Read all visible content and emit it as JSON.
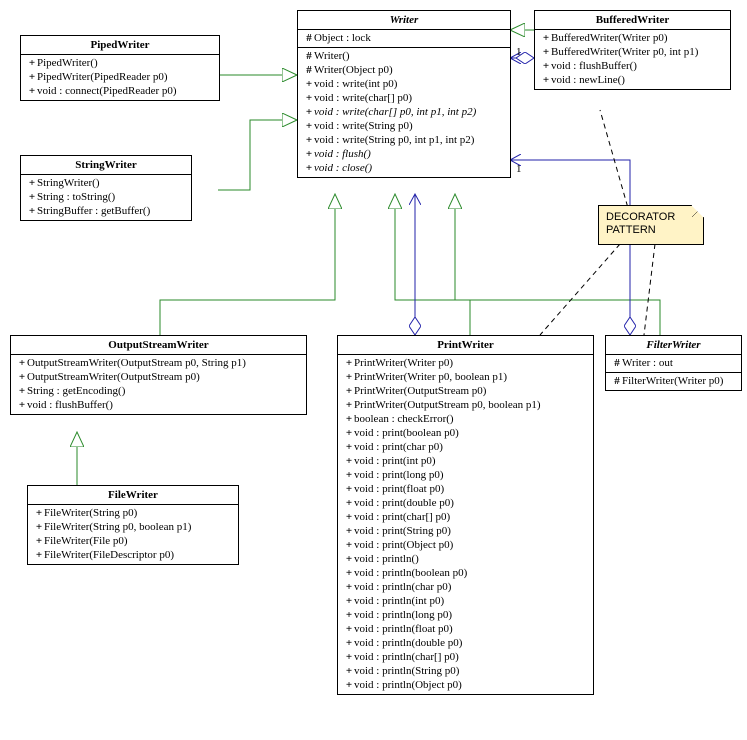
{
  "note": {
    "line1": "DECORATOR",
    "line2": "PATTERN"
  },
  "classes": {
    "Writer": {
      "name": "Writer",
      "abstract": true,
      "attrs": [
        {
          "vis": "#",
          "text": "Object : lock"
        }
      ],
      "ops": [
        {
          "vis": "#",
          "text": "Writer()"
        },
        {
          "vis": "#",
          "text": "Writer(Object p0)"
        },
        {
          "vis": "+",
          "text": "void : write(int p0)"
        },
        {
          "vis": "+",
          "text": "void : write(char[] p0)"
        },
        {
          "vis": "+",
          "text": "void : write(char[] p0, int p1, int p2)",
          "italic": true
        },
        {
          "vis": "+",
          "text": "void : write(String p0)"
        },
        {
          "vis": "+",
          "text": "void : write(String p0, int p1, int p2)"
        },
        {
          "vis": "+",
          "text": "void : flush()",
          "italic": true
        },
        {
          "vis": "+",
          "text": "void : close()",
          "italic": true
        }
      ]
    },
    "BufferedWriter": {
      "name": "BufferedWriter",
      "ops": [
        {
          "vis": "+",
          "text": "BufferedWriter(Writer p0)"
        },
        {
          "vis": "+",
          "text": "BufferedWriter(Writer p0, int p1)"
        },
        {
          "vis": "+",
          "text": "void : flushBuffer()"
        },
        {
          "vis": "+",
          "text": "void : newLine()"
        }
      ]
    },
    "PipedWriter": {
      "name": "PipedWriter",
      "ops": [
        {
          "vis": "+",
          "text": "PipedWriter()"
        },
        {
          "vis": "+",
          "text": "PipedWriter(PipedReader p0)"
        },
        {
          "vis": "+",
          "text": "void : connect(PipedReader p0)"
        }
      ]
    },
    "StringWriter": {
      "name": "StringWriter",
      "ops": [
        {
          "vis": "+",
          "text": "StringWriter()"
        },
        {
          "vis": "+",
          "text": "String : toString()"
        },
        {
          "vis": "+",
          "text": "StringBuffer : getBuffer()"
        }
      ]
    },
    "OutputStreamWriter": {
      "name": "OutputStreamWriter",
      "ops": [
        {
          "vis": "+",
          "text": "OutputStreamWriter(OutputStream p0, String p1)"
        },
        {
          "vis": "+",
          "text": "OutputStreamWriter(OutputStream p0)"
        },
        {
          "vis": "+",
          "text": "String : getEncoding()"
        },
        {
          "vis": "+",
          "text": "void : flushBuffer()"
        }
      ]
    },
    "FileWriter": {
      "name": "FileWriter",
      "ops": [
        {
          "vis": "+",
          "text": "FileWriter(String p0)"
        },
        {
          "vis": "+",
          "text": "FileWriter(String p0, boolean p1)"
        },
        {
          "vis": "+",
          "text": "FileWriter(File p0)"
        },
        {
          "vis": "+",
          "text": "FileWriter(FileDescriptor p0)"
        }
      ]
    },
    "PrintWriter": {
      "name": "PrintWriter",
      "ops": [
        {
          "vis": "+",
          "text": "PrintWriter(Writer p0)"
        },
        {
          "vis": "+",
          "text": "PrintWriter(Writer p0, boolean p1)"
        },
        {
          "vis": "+",
          "text": "PrintWriter(OutputStream p0)"
        },
        {
          "vis": "+",
          "text": "PrintWriter(OutputStream p0, boolean p1)"
        },
        {
          "vis": "+",
          "text": "boolean : checkError()"
        },
        {
          "vis": "+",
          "text": "void : print(boolean p0)"
        },
        {
          "vis": "+",
          "text": "void : print(char p0)"
        },
        {
          "vis": "+",
          "text": "void : print(int p0)"
        },
        {
          "vis": "+",
          "text": "void : print(long p0)"
        },
        {
          "vis": "+",
          "text": "void : print(float p0)"
        },
        {
          "vis": "+",
          "text": "void : print(double p0)"
        },
        {
          "vis": "+",
          "text": "void : print(char[] p0)"
        },
        {
          "vis": "+",
          "text": "void : print(String p0)"
        },
        {
          "vis": "+",
          "text": "void : print(Object p0)"
        },
        {
          "vis": "+",
          "text": "void : println()"
        },
        {
          "vis": "+",
          "text": "void : println(boolean p0)"
        },
        {
          "vis": "+",
          "text": "void : println(char p0)"
        },
        {
          "vis": "+",
          "text": "void : println(int p0)"
        },
        {
          "vis": "+",
          "text": "void : println(long p0)"
        },
        {
          "vis": "+",
          "text": "void : println(float p0)"
        },
        {
          "vis": "+",
          "text": "void : println(double p0)"
        },
        {
          "vis": "+",
          "text": "void : println(char[] p0)"
        },
        {
          "vis": "+",
          "text": "void : println(String p0)"
        },
        {
          "vis": "+",
          "text": "void : println(Object p0)"
        }
      ]
    },
    "FilterWriter": {
      "name": "FilterWriter",
      "abstract": true,
      "attrs": [
        {
          "vis": "#",
          "text": "Writer : out"
        }
      ],
      "ops": [
        {
          "vis": "#",
          "text": "FilterWriter(Writer p0)"
        }
      ]
    }
  },
  "edgeLabels": {
    "bw_one": "1",
    "fw_one": "1"
  }
}
